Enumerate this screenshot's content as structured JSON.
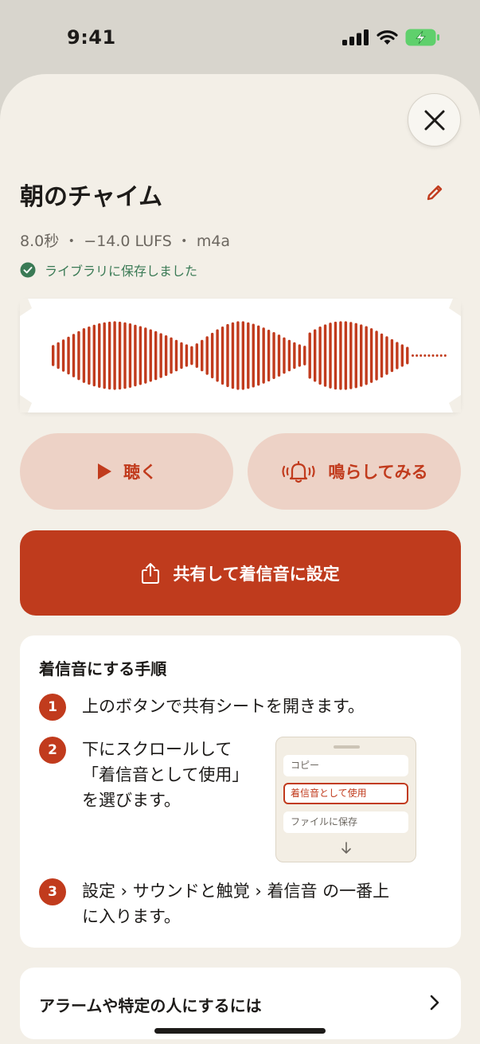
{
  "status_bar": {
    "time": "9:41"
  },
  "sheet": {
    "title": "朝のチャイム",
    "meta": "8.0秒 ・ −14.0 LUFS ・ m4a",
    "saved_status": "ライブラリに保存しました"
  },
  "waveform": {
    "bar_levels": [
      0.3,
      0.38,
      0.46,
      0.54,
      0.62,
      0.7,
      0.78,
      0.83,
      0.88,
      0.92,
      0.95,
      0.97,
      0.98,
      0.97,
      0.95,
      0.92,
      0.88,
      0.84,
      0.8,
      0.75,
      0.7,
      0.64,
      0.58,
      0.52,
      0.45,
      0.38,
      0.32,
      0.27,
      0.35,
      0.45,
      0.55,
      0.65,
      0.75,
      0.83,
      0.9,
      0.95,
      0.98,
      0.98,
      0.95,
      0.91,
      0.86,
      0.8,
      0.74,
      0.67,
      0.6,
      0.52,
      0.45,
      0.38,
      0.32,
      0.28,
      0.66,
      0.75,
      0.83,
      0.89,
      0.94,
      0.97,
      0.98,
      0.98,
      0.96,
      0.93,
      0.89,
      0.84,
      0.78,
      0.71,
      0.63,
      0.55,
      0.47,
      0.39,
      0.32,
      0.25
    ],
    "trailing_dots": 9,
    "colors": {
      "bar": "#c13b1d"
    }
  },
  "actions": {
    "listen_label": "聴く",
    "ring_label": "鳴らしてみる",
    "share_label": "共有して着信音に設定"
  },
  "steps": {
    "title": "着信音にする手順",
    "items": [
      {
        "number": "1",
        "lines": [
          "上のボタンで共有シートを開きます。"
        ]
      },
      {
        "number": "2",
        "lines": [
          "下にスクロールして",
          "「着信音として使用」",
          "を選びます。"
        ]
      },
      {
        "number": "3",
        "lines": [
          "設定 › サウンドと触覚 › 着信音 の一番上",
          "に入ります。"
        ]
      }
    ],
    "share_sheet_preview": {
      "items": [
        "コピー",
        "着信音として使用",
        "ファイルに保存"
      ],
      "highlighted_item": "着信音として使用"
    }
  },
  "more": {
    "label": "アラームや特定の人にするには"
  },
  "colors": {
    "background": "#f3efe7",
    "accent": "#c13b1d",
    "accent_soft": "#edd2c6",
    "success": "#3a7a55"
  }
}
